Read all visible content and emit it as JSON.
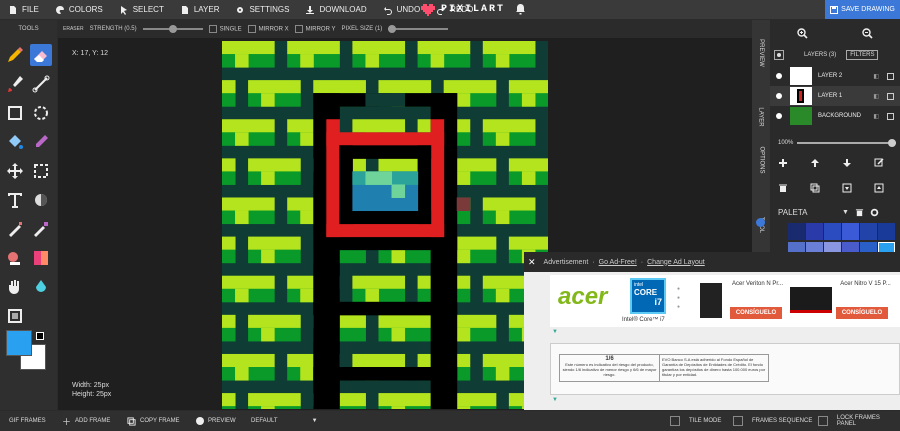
{
  "menu": {
    "items": [
      {
        "label": "FILE",
        "icon": "file-icon"
      },
      {
        "label": "COLORS",
        "icon": "palette-icon"
      },
      {
        "label": "SELECT",
        "icon": "select-icon"
      },
      {
        "label": "LAYER",
        "icon": "layer-icon"
      },
      {
        "label": "SETTINGS",
        "icon": "gear-icon"
      },
      {
        "label": "DOWNLOAD",
        "icon": "download-icon"
      },
      {
        "label": "UNDO",
        "icon": "undo-icon"
      },
      {
        "label": "REDO",
        "icon": "redo-icon"
      }
    ],
    "logo_text": "PIXILART",
    "save_label": "SAVE DRAWING"
  },
  "options": {
    "tool_name": "ERASER",
    "strength_label": "STRENGTH (0.5)",
    "strength_value": 0.5,
    "single_label": "SINGLE",
    "mirror_x_label": "MIRROR X",
    "mirror_y_label": "MIRROR Y",
    "pixel_size_label": "PIXEL SIZE (1)",
    "pixel_size_value": 1
  },
  "tools": {
    "title": "TOOLS",
    "items": [
      "pencil-icon",
      "eraser-icon",
      "brush-icon",
      "line-icon",
      "rectangle-icon",
      "circle-select-icon",
      "fill-bucket-icon",
      "eyedropper-icon",
      "move-icon",
      "select-rect-icon",
      "text-icon",
      "shade-icon",
      "dither-icon",
      "magic-wand-icon",
      "stamp-icon",
      "gradient-icon",
      "hand-icon",
      "droplet-icon",
      "crop-icon"
    ],
    "active": "eraser-icon",
    "primary_color": "#29a1f0",
    "secondary_color": "#ffffff"
  },
  "canvas": {
    "coord_text": "X: 17, Y: 12",
    "width_text": "Width: 25px",
    "height_text": "Height: 25px",
    "colors": {
      "bg": "#0f3d35",
      "green": "#0a9a2a",
      "lime": "#b3e41d",
      "red": "#e02020",
      "black": "#000000",
      "teal": "#2ba39a",
      "mint": "#6fd49a",
      "blue": "#1f7faf"
    }
  },
  "right_panel": {
    "tabs": [
      "PREVIEW",
      "LAYER",
      "OPTIONS",
      "TOOL"
    ],
    "layers_title": "LAYERS (3)",
    "filters_label": "FILTERS",
    "layers": [
      {
        "name": "LAYER 2"
      },
      {
        "name": "LAYER 1"
      },
      {
        "name": "BACKGROUND"
      }
    ],
    "opacity_text": "100%",
    "palette_name": "PALETA",
    "palette_colors": [
      "#1a2a6e",
      "#2a3aa8",
      "#2a4cc0",
      "#3a5ad8",
      "#2244aa",
      "#1a3a9a",
      "#5570c8",
      "#6a80d8",
      "#8a96e0",
      "#4a5ccc",
      "#2a5fc8",
      "#29a1f0"
    ]
  },
  "bottom": {
    "gif_frames": "GIF FRAMES",
    "add_frame": "ADD FRAME",
    "copy_frame": "COPY FRAME",
    "preview": "PREVIEW",
    "speed": "DEFAULT",
    "tile_mode": "TILE MODE",
    "frames_sequence": "FRAMES SEQUENCE",
    "lock_frames_panel": "LOCK FRAMES PANEL"
  },
  "ad": {
    "label": "Advertisement",
    "sep": "·",
    "go_ad_free": "Go Ad-Free!",
    "change_layout": "Change Ad Layout",
    "brand": "acer",
    "chip_brand": "intel",
    "chip_name": "CORE",
    "chip_gen": "i7",
    "chip_caption": "Intel® Core™ i7",
    "product1_name": "Acer Veriton N Pr...",
    "product2_name": "Acer Nitro V 15 P...",
    "cta": "CONSÍGUELO",
    "notice_rank": "1/6",
    "notice_left": "Este número es indicativo del riesgo del producto, siendo 1/6 indicativo de menor riesgo y 6/6 de mayor riesgo.",
    "notice_right": "EVO Banco S.A está adherido al Fondo Español de Garantía de Depósitos de Entidades de Crédito. El fondo garantiza los depósitos de dinero hasta 100.000 euros por titular y por entidad."
  }
}
